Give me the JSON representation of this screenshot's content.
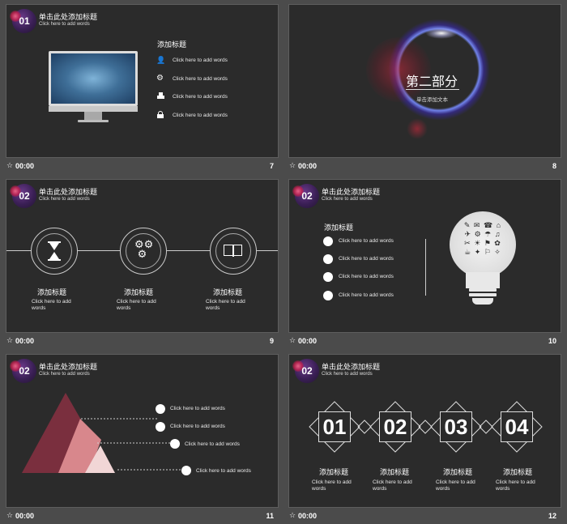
{
  "footer": {
    "time": "00:00",
    "star": "☆"
  },
  "slides": {
    "s7": {
      "badge": "01",
      "title": "单击此处添加标题",
      "subtitle": "Click here to add words",
      "heading": "添加标题",
      "items": [
        "Click here to add words",
        "Click here to add words",
        "Click here to add words",
        "Click here to add words"
      ],
      "icons": [
        "user-icon",
        "gear-icon",
        "stamp-icon",
        "lock-icon"
      ],
      "page": "7"
    },
    "s8": {
      "heading": "第二部分",
      "sub": "单击添加文本",
      "page": "8"
    },
    "s9": {
      "badge": "02",
      "title": "单击此处添加标题",
      "subtitle": "Click here to add words",
      "cols": [
        {
          "heading": "添加标题",
          "text": "Click here to add words",
          "icon": "hourglass-icon"
        },
        {
          "heading": "添加标题",
          "text": "Click here to add words",
          "icon": "gears-icon"
        },
        {
          "heading": "添加标题",
          "text": "Click here to add words",
          "icon": "book-icon"
        }
      ],
      "page": "9"
    },
    "s10": {
      "badge": "02",
      "title": "单击此处添加标题",
      "subtitle": "Click here to add words",
      "heading": "添加标题",
      "items": [
        "Click here to add words",
        "Click here to add words",
        "Click here to add words",
        "Click here to add words"
      ],
      "page": "10"
    },
    "s11": {
      "badge": "02",
      "title": "单击此处添加标题",
      "subtitle": "Click here to add words",
      "items": [
        "Click here to add words",
        "Click here to add words",
        "Click here to add words",
        "Click here to add words"
      ],
      "colors": [
        "#7a2f3e",
        "#d8878c",
        "#f1d6d6"
      ],
      "page": "11"
    },
    "s12": {
      "badge": "02",
      "title": "单击此处添加标题",
      "subtitle": "Click here to add words",
      "steps": [
        {
          "num": "01",
          "heading": "添加标题",
          "text": "Click here to add words"
        },
        {
          "num": "02",
          "heading": "添加标题",
          "text": "Click here to add words"
        },
        {
          "num": "03",
          "heading": "添加标题",
          "text": "Click here to add words"
        },
        {
          "num": "04",
          "heading": "添加标题",
          "text": "Click here to add words"
        }
      ],
      "page": "12"
    }
  }
}
